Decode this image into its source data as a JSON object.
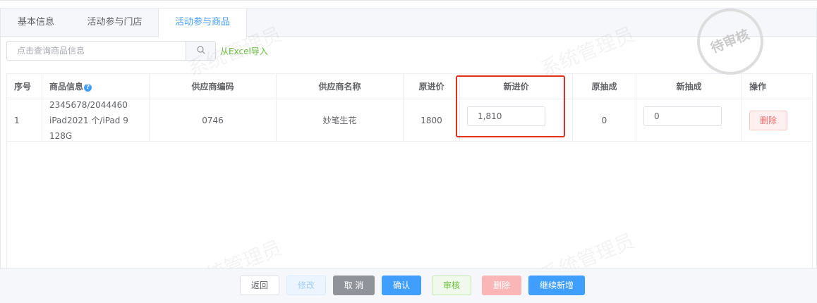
{
  "tabs": [
    {
      "label": "基本信息",
      "active": false
    },
    {
      "label": "活动参与门店",
      "active": false
    },
    {
      "label": "活动参与商品",
      "active": true
    }
  ],
  "search": {
    "placeholder": "点击查询商品信息",
    "icon": "search-icon"
  },
  "import_link": "从Excel导入",
  "table": {
    "headers": [
      "序号",
      "商品信息",
      "供应商编码",
      "供应商名称",
      "原进价",
      "新进价",
      "原抽成",
      "新抽成",
      "操作"
    ],
    "rows": [
      {
        "index": "1",
        "info_line1": "2345678/2044460",
        "info_line2": "iPad2021 个/iPad 9 128G",
        "supplier_code": "0746",
        "supplier_name": "妙笔生花",
        "orig_price": "1800",
        "new_price": "1,810",
        "orig_commission": "0",
        "new_commission": "0",
        "action": "删除"
      }
    ]
  },
  "watermark_text": "系统管理员",
  "stamp_text": "待审核",
  "footer": {
    "back": "返回",
    "edit": "修改",
    "cancel": "取 消",
    "confirm": "确认",
    "audit": "审核",
    "delete": "删除",
    "continue_add": "继续新增"
  },
  "colors": {
    "primary": "#409eff",
    "success": "#67c23a",
    "danger": "#f56c6c",
    "highlight": "#e0301e"
  }
}
